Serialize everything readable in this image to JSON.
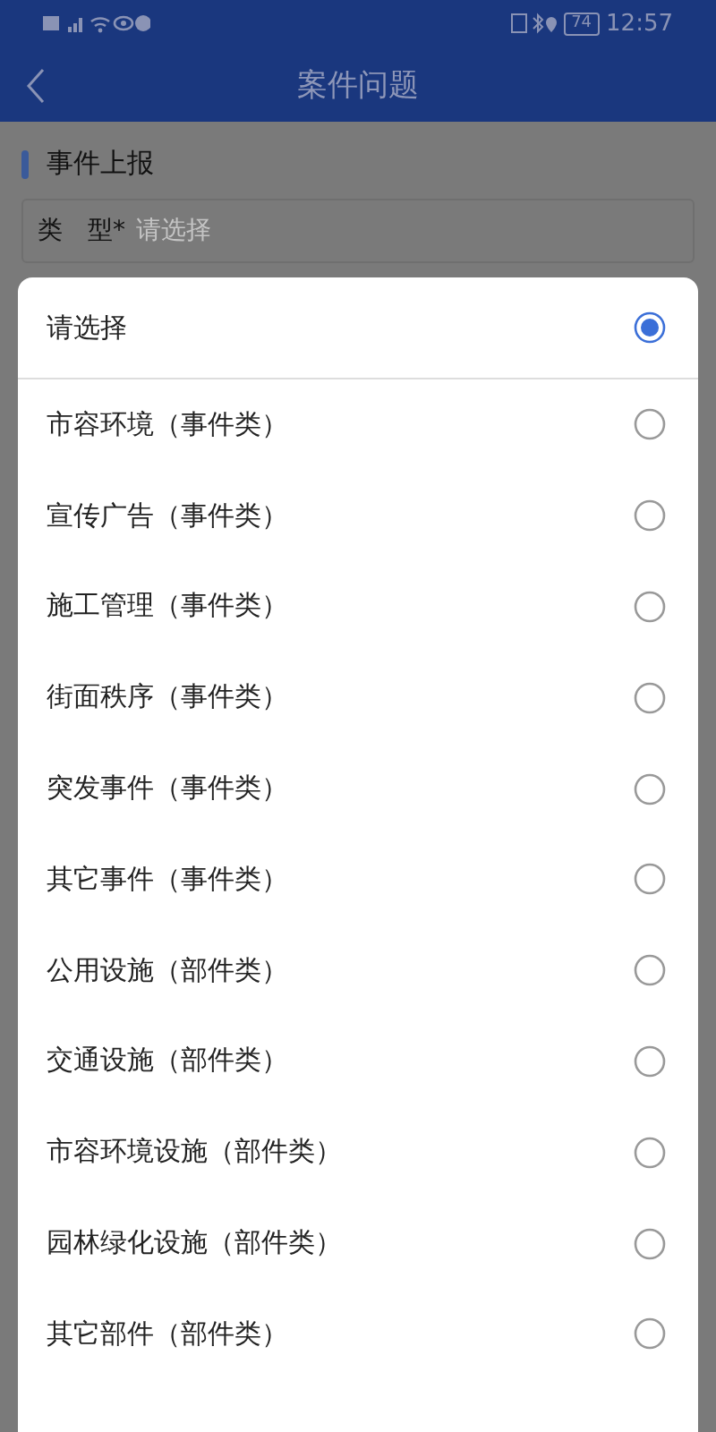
{
  "status_bar": {
    "battery": "74",
    "time": "12:57"
  },
  "header": {
    "title": "案件问题"
  },
  "section": {
    "title": "事件上报"
  },
  "field": {
    "label": "类　型*",
    "placeholder": "请选择"
  },
  "dialog": {
    "options": [
      {
        "label": "请选择",
        "selected": true
      },
      {
        "label": "市容环境（事件类）",
        "selected": false
      },
      {
        "label": "宣传广告（事件类）",
        "selected": false
      },
      {
        "label": "施工管理（事件类）",
        "selected": false
      },
      {
        "label": "街面秩序（事件类）",
        "selected": false
      },
      {
        "label": "突发事件（事件类）",
        "selected": false
      },
      {
        "label": "其它事件（事件类）",
        "selected": false
      },
      {
        "label": "公用设施（部件类）",
        "selected": false
      },
      {
        "label": "交通设施（部件类）",
        "selected": false
      },
      {
        "label": "市容环境设施（部件类）",
        "selected": false
      },
      {
        "label": "园林绿化设施（部件类）",
        "selected": false
      },
      {
        "label": "其它部件（部件类）",
        "selected": false
      }
    ]
  }
}
